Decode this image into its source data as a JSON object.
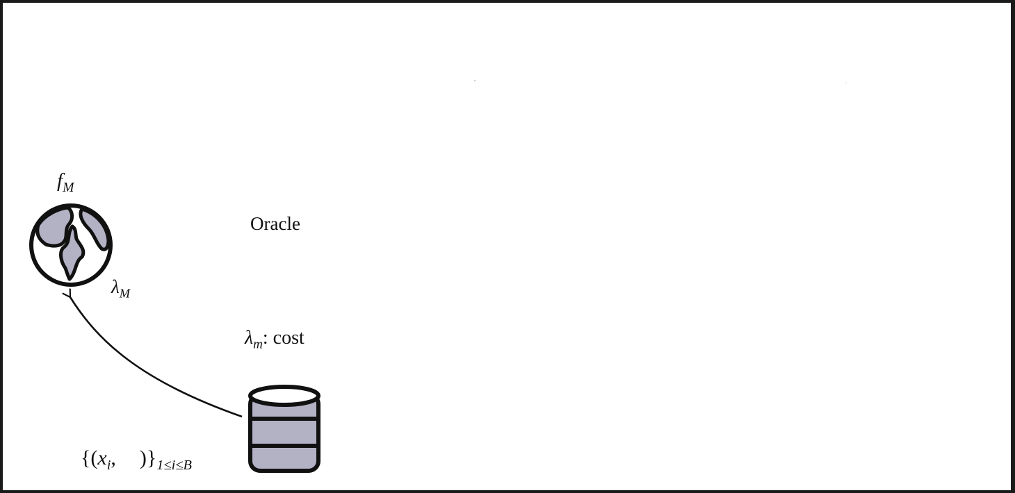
{
  "globe": {
    "label_name": "f",
    "label_sub": "M",
    "icon": "globe-icon",
    "fill": "#b3b1c4"
  },
  "arrow": {
    "label_name": "λ",
    "label_sub": "M"
  },
  "oracle": {
    "label": "Oracle"
  },
  "database": {
    "icon": "database-icon",
    "fill": "#b3b1c4",
    "cost_name": "λ",
    "cost_sub": "m",
    "cost_text": ": cost"
  },
  "dataset": {
    "open": "{(",
    "var_name": "x",
    "var_sub": "i",
    "mid": ",",
    "close": ")}",
    "range_sub": "1≤i≤B"
  },
  "colors": {
    "stroke": "#111111",
    "fill": "#b3b1c4",
    "frame": "#1a1a1a"
  }
}
